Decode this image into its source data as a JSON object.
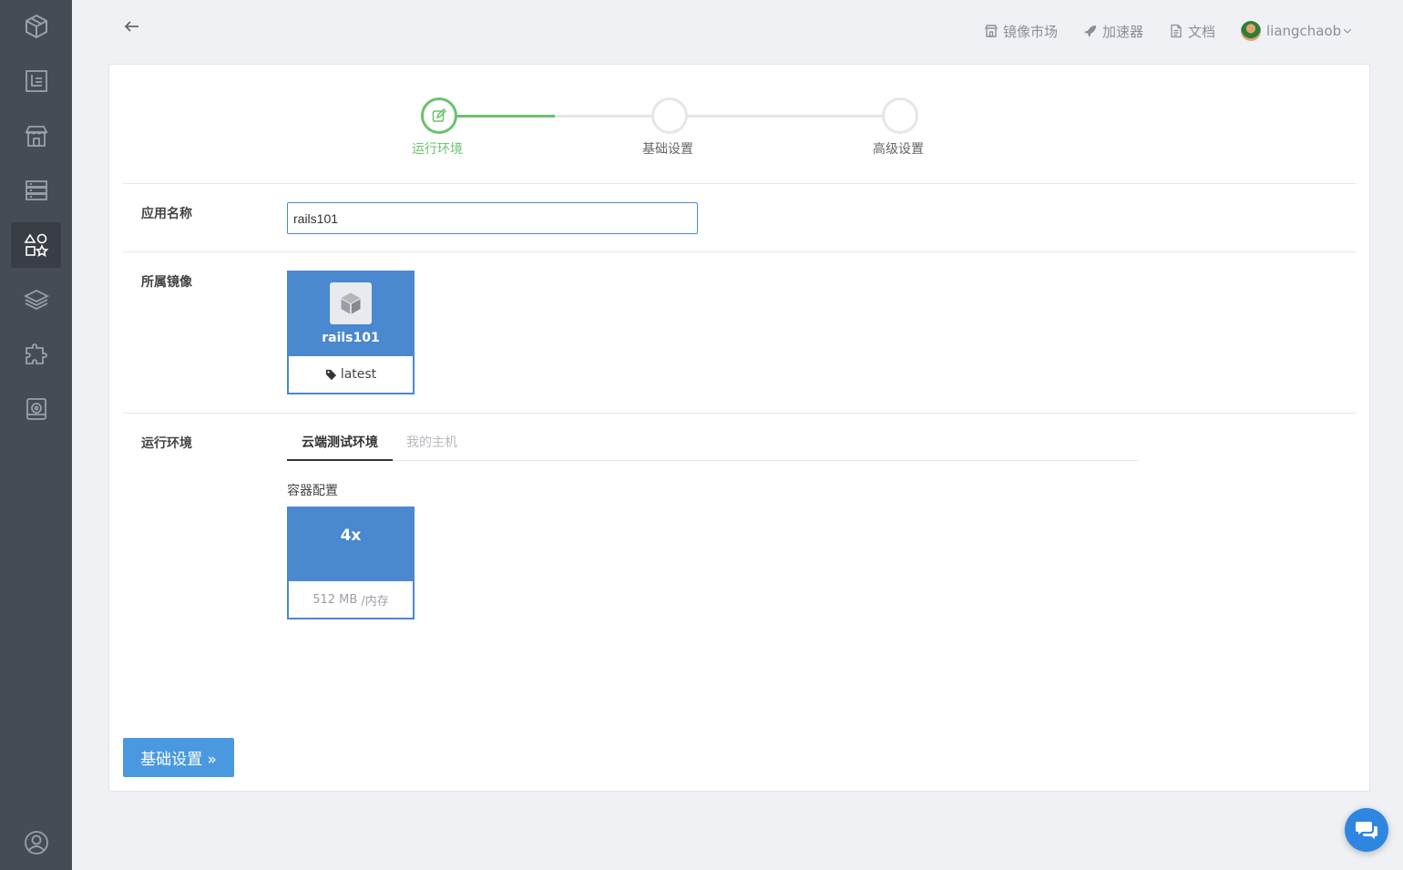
{
  "topbar": {
    "market_label": "镜像市场",
    "accelerator_label": "加速器",
    "docs_label": "文档",
    "username": "liangchaob"
  },
  "sidebar": {
    "items": [
      {
        "icon": "logo-cube-icon"
      },
      {
        "icon": "dashboard-icon"
      },
      {
        "icon": "store-icon"
      },
      {
        "icon": "server-icon"
      },
      {
        "icon": "apps-shapes-icon",
        "active": true
      },
      {
        "icon": "layers-icon"
      },
      {
        "icon": "puzzle-icon"
      },
      {
        "icon": "disk-icon"
      },
      {
        "icon": "user-icon"
      }
    ]
  },
  "stepper": {
    "steps": [
      {
        "label": "运行环境",
        "status": "done"
      },
      {
        "label": "基础设置",
        "status": "pending"
      },
      {
        "label": "高级设置",
        "status": "pending"
      }
    ]
  },
  "form": {
    "app_name_label": "应用名称",
    "app_name_value": "rails101",
    "image_label": "所属镜像",
    "image": {
      "name": "rails101",
      "tag": "latest"
    },
    "runtime_label": "运行环境",
    "tabs": [
      {
        "label": "云端测试环境",
        "active": true
      },
      {
        "label": "我的主机",
        "active": false
      }
    ],
    "container_config_label": "容器配置",
    "container": {
      "size": "4x",
      "memory": "512 MB",
      "memory_suffix": "/内存"
    }
  },
  "next_button_label": "基础设置 »",
  "colors": {
    "accent": "#4a88d0",
    "success": "#6cc16e",
    "sidebar": "#464c56"
  }
}
